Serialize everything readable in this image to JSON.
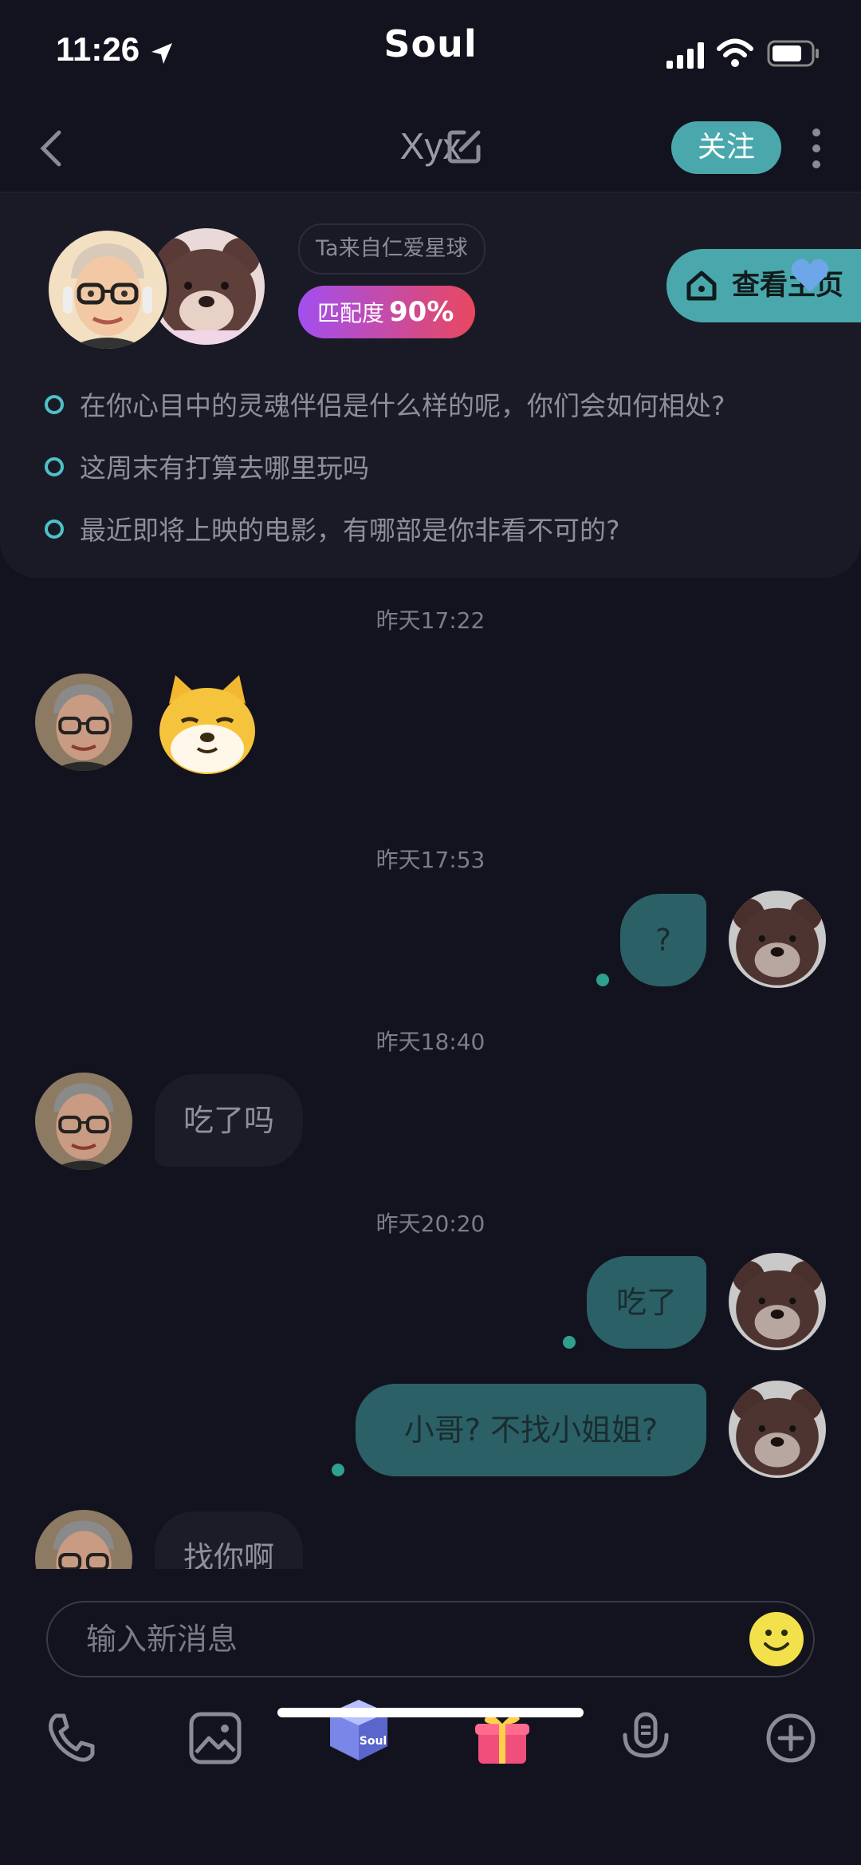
{
  "status_bar": {
    "time": "11:26",
    "carrier_logo": "Soul"
  },
  "nav": {
    "title": "Xyx",
    "follow_label": "关注"
  },
  "profile": {
    "origin": "Ta来自仁爱星球",
    "match_label": "匹配度",
    "match_value": "90%",
    "homepage_label": "查看主页",
    "topics": [
      "在你心目中的灵魂伴侣是什么样的呢，你们会如何相处?",
      "这周末有打算去哪里玩吗",
      "最近即将上映的电影，有哪部是你非看不可的?"
    ]
  },
  "messages": {
    "ts1": "昨天17:22",
    "ts2": "昨天17:53",
    "ts3": "昨天18:40",
    "ts4": "昨天20:20",
    "m_out_1": "?",
    "m_in_2": "吃了吗",
    "m_out_3": "吃了",
    "m_out_4": "小哥?  不找小姐姐?",
    "m_in_5": "找你啊"
  },
  "composer": {
    "placeholder": "输入新消息",
    "tools": [
      "phone-icon",
      "image-icon",
      "soul-box-icon",
      "gift-icon",
      "voice-icon",
      "plus-icon"
    ],
    "box_logo": "Soul"
  },
  "colors": {
    "accent": "#4aa8ad",
    "background": "#13131f",
    "card": "#1a1a27",
    "out_bubble": "#2b6166"
  }
}
